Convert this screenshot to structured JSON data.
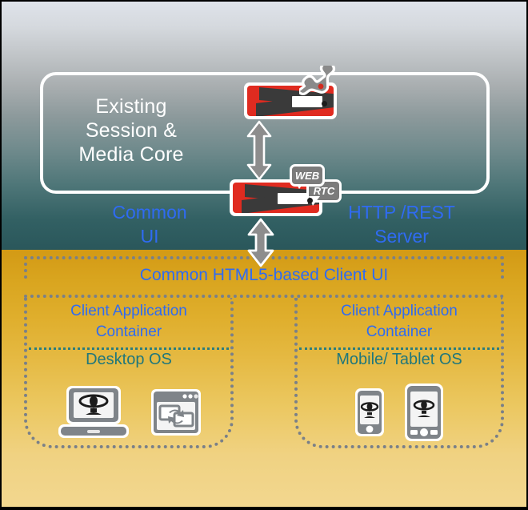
{
  "diagram": {
    "title_core": "Existing\nSession &\nMedia Core",
    "core_line1": "Existing",
    "core_line2": "Session &",
    "core_line3": "Media Core",
    "label_common_ui_line1": "Common",
    "label_common_ui_line2": "UI",
    "label_http_rest_line1": "HTTP /REST",
    "label_http_rest_line2": "Server",
    "band_html5": "Common HTML5-based Client UI",
    "badge_web": "WEB",
    "badge_rtc": "RTC",
    "columns": [
      {
        "container_line1": "Client Application",
        "container_line2": "Container",
        "os": "Desktop OS",
        "devices": [
          "laptop-icon",
          "browser-screenshare-icon"
        ]
      },
      {
        "container_line1": "Client Application",
        "container_line2": "Container",
        "os": "Mobile/ Tablet OS",
        "devices": [
          "smartphone-icon",
          "tablet-icon"
        ]
      }
    ],
    "colors": {
      "accent_blue": "#2f6bf2",
      "os_teal": "#20777b",
      "server_red": "#e02b20",
      "server_dark": "#3a3a3a",
      "dash_gray": "#7a8088",
      "sky_top": "#dfe3ea",
      "teal_bottom": "#2a575b",
      "gold_top": "#d39a15",
      "gold_bottom": "#f2d78f",
      "white": "#ffffff"
    },
    "arrows": [
      {
        "name": "core-to-server",
        "direction": "bidirectional-vertical"
      },
      {
        "name": "server-to-client",
        "direction": "bidirectional-vertical"
      }
    ]
  }
}
